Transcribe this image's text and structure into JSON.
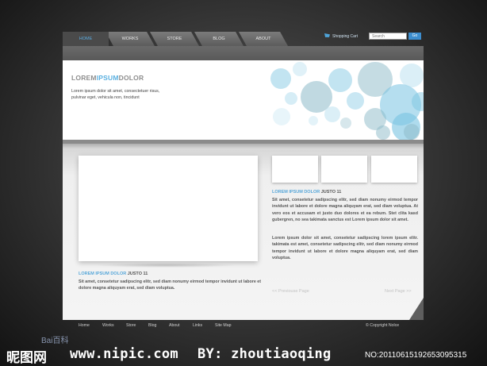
{
  "nav": {
    "tabs": [
      {
        "label": "HOME"
      },
      {
        "label": "WORKS"
      },
      {
        "label": "STORE"
      },
      {
        "label": "BLOG"
      },
      {
        "label": "ABOUT"
      }
    ],
    "cart_label": "Shopping Cart",
    "search_placeholder": "Search",
    "search_button": "Go"
  },
  "hero": {
    "title_a": "LOREM",
    "title_b": "IPSUM",
    "title_c": "DOLOR",
    "text": "Lorem ipsum dolor sit amet, consectetuer risus, pulvinar eget, vehicula non, tincidunt"
  },
  "right": {
    "title_blue": "LOREM IPSUM DOLOR",
    "title_dark": "JUSTO 11",
    "para1": "Sit amet, consetetur sadipscing elitr, sed diam nonumy eirmod tempor invidunt ut labore et dolore magna aliquyam erat, sed diam voluptua. At vero eos et accusam et justo duo dolores et ea rebum. Stet clita kasd gubergren, no sea takimata sanctus est Lorem ipsum dolor sit amet.",
    "para2": "Lorem ipsum dolor sit amet, consetetur sadipscing lorem ipsum elitr. takimata est amet, consetetur sadipscing elitr, sed diam nonumy eirmod tempor invidunt ut labore et dolore magna aliquyam erat, sed diam voluptua."
  },
  "left": {
    "title_blue": "LOREM IPSUM DOLOR",
    "title_dark": "JUSTO 11",
    "para": "Sit amet, consetetur sadipscing elitr, sed diam nonumy eirmod tempor invidunt ut labore et dolore magna aliquyam erat, sed diam voluptua."
  },
  "pager": {
    "prev": "<< Previouse Page",
    "next": "Next Page >>"
  },
  "footer": {
    "links": [
      "Home",
      "Works",
      "Store",
      "Blog",
      "About",
      "Links",
      "Site Map"
    ],
    "copyright": "© Copyright Nolce"
  },
  "watermark": {
    "baidu": "Bai百科",
    "logo": "昵图网",
    "site": "www.nipic.com",
    "by": "BY: zhoutiaoqing",
    "no": "NO:20110615192653095315"
  },
  "colors": {
    "accent": "#57a7d9",
    "bubble": "#8fd0ea"
  }
}
